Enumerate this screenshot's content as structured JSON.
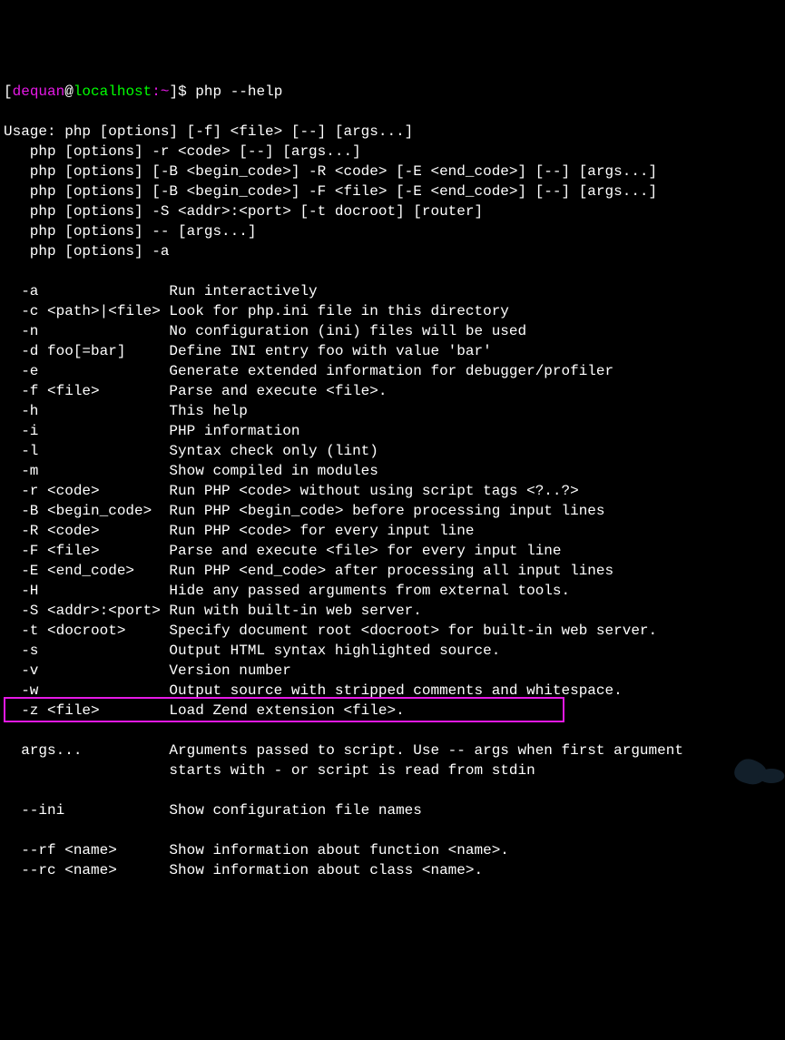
{
  "prompt": {
    "open_bracket": "[",
    "user": "dequan",
    "at": "@",
    "host": "localhost",
    "colon": ":",
    "path": "~",
    "close_bracket": "]",
    "dollar": "$ ",
    "command": "php --help"
  },
  "output": {
    "l1": "Usage: php [options] [-f] <file> [--] [args...]",
    "l2": "   php [options] -r <code> [--] [args...]",
    "l3": "   php [options] [-B <begin_code>] -R <code> [-E <end_code>] [--] [args...]",
    "l4": "   php [options] [-B <begin_code>] -F <file> [-E <end_code>] [--] [args...]",
    "l5": "   php [options] -S <addr>:<port> [-t docroot] [router]",
    "l6": "   php [options] -- [args...]",
    "l7": "   php [options] -a",
    "l8": "",
    "l9": "  -a               Run interactively",
    "l10": "  -c <path>|<file> Look for php.ini file in this directory",
    "l11": "  -n               No configuration (ini) files will be used",
    "l12": "  -d foo[=bar]     Define INI entry foo with value 'bar'",
    "l13": "  -e               Generate extended information for debugger/profiler",
    "l14": "  -f <file>        Parse and execute <file>.",
    "l15": "  -h               This help",
    "l16": "  -i               PHP information",
    "l17": "  -l               Syntax check only (lint)",
    "l18": "  -m               Show compiled in modules",
    "l19": "  -r <code>        Run PHP <code> without using script tags <?..?>",
    "l20": "  -B <begin_code>  Run PHP <begin_code> before processing input lines",
    "l21": "  -R <code>        Run PHP <code> for every input line",
    "l22": "  -F <file>        Parse and execute <file> for every input line",
    "l23": "  -E <end_code>    Run PHP <end_code> after processing all input lines",
    "l24": "  -H               Hide any passed arguments from external tools.",
    "l25": "  -S <addr>:<port> Run with built-in web server.",
    "l26": "  -t <docroot>     Specify document root <docroot> for built-in web server.",
    "l27": "  -s               Output HTML syntax highlighted source.",
    "l28": "  -v               Version number",
    "l29": "  -w               Output source with stripped comments and whitespace.",
    "l30": "  -z <file>        Load Zend extension <file>.",
    "l31": "",
    "l32": "  args...          Arguments passed to script. Use -- args when first argument",
    "l33": "                   starts with - or script is read from stdin",
    "l34": "",
    "l35": "  --ini            Show configuration file names",
    "l36": "",
    "l37": "  --rf <name>      Show information about function <name>.",
    "l38": "  --rc <name>      Show information about class <name>."
  }
}
